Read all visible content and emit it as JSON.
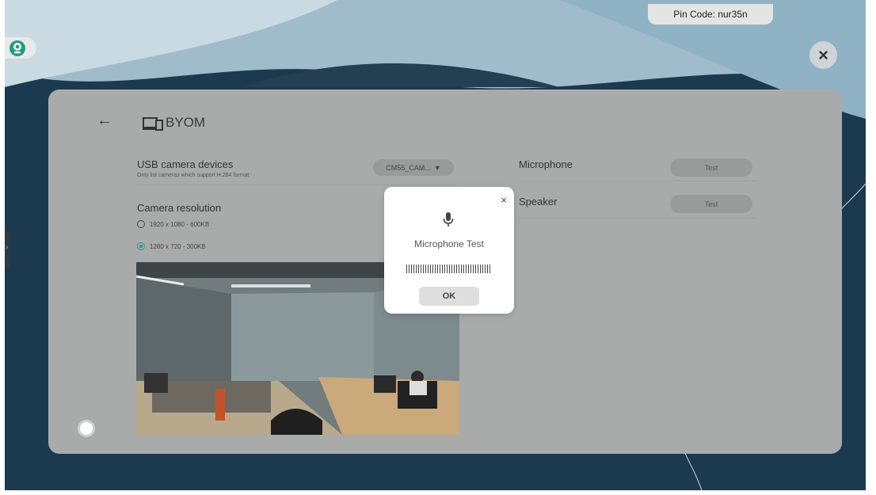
{
  "pin_code": "Pin Code:  nur35n",
  "icons": {
    "camera": "webcam-icon",
    "close": "close-icon",
    "back": "back-arrow-icon",
    "byom": "devices-icon",
    "mic": "microphone-icon",
    "record": "record-button-icon"
  },
  "panel": {
    "title": "BYOM",
    "usb": {
      "label": "USB camera devices",
      "sub": "Only list cameras which support H.264 format",
      "selected": "CM55_CAM..."
    },
    "resolution": {
      "label": "Camera resolution",
      "options": [
        {
          "label": "1920 x 1080 - 600KB",
          "selected": false
        },
        {
          "label": "1280 x 720 - 300KB",
          "selected": true
        }
      ]
    },
    "microphone": {
      "label": "Microphone",
      "button": "Test"
    },
    "speaker": {
      "label": "Speaker",
      "button": "Test"
    }
  },
  "dialog": {
    "title": "Microphone Test",
    "ok": "OK",
    "close": "×"
  },
  "colors": {
    "accent": "#1e9c86",
    "panel": "#a9abab",
    "background": "#1a3548"
  }
}
